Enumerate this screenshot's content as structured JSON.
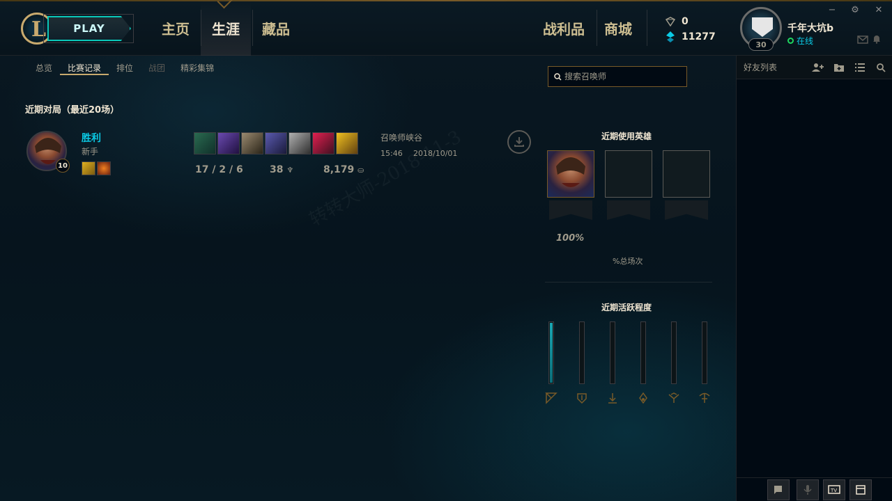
{
  "header": {
    "play_label": "PLAY",
    "nav_main": [
      "主页",
      "生涯",
      "藏品"
    ],
    "nav_right": [
      "战利品",
      "商城"
    ],
    "currency": {
      "rp": "0",
      "be": "11277"
    },
    "profile": {
      "name": "千年大坑b",
      "status": "在线",
      "level": "30"
    },
    "window_controls": [
      "−",
      "⚙",
      "✕"
    ]
  },
  "subtabs": [
    "总览",
    "比赛记录",
    "排位",
    "战团",
    "精彩集锦"
  ],
  "search": {
    "placeholder": "搜索召唤师"
  },
  "recent_matches": {
    "title": "近期对局（最近20场）",
    "matches": [
      {
        "result": "胜利",
        "queue": "新手",
        "champion_level": "10",
        "kda": "17 / 2 / 6",
        "cs": "38",
        "gold": "8,179",
        "map": "召唤师峡谷",
        "time": "15:46",
        "date": "2018/10/01"
      }
    ]
  },
  "right_panel": {
    "recent_champs_title": "近期使用英雄",
    "top_champ_percent": "100%",
    "percent_label": "%总场次",
    "activity_title": "近期活跃程度",
    "activity_levels": [
      1.0,
      0,
      0,
      0,
      0,
      0
    ],
    "roles": [
      "top-icon",
      "jungle-icon",
      "mid-icon",
      "bot-icon",
      "support-icon",
      "fill-icon"
    ]
  },
  "friends": {
    "title": "好友列表"
  },
  "watermark": "转转大师-2018-11-3",
  "colors": {
    "accent": "#0acbe6",
    "gold": "#c8aa6e",
    "text_light": "#f0e6d2",
    "text_dim": "#a09b8c"
  }
}
